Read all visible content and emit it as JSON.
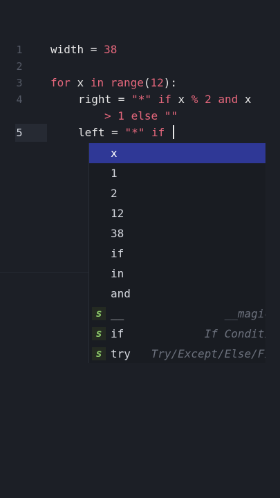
{
  "lines": [
    {
      "num": "1",
      "parts": [
        "width",
        " = ",
        "38"
      ]
    },
    {
      "num": "2"
    },
    {
      "num": "3",
      "parts": [
        "for",
        " x ",
        "in",
        " ",
        "range",
        "(",
        "12",
        "):"
      ]
    },
    {
      "num": "4",
      "parts": [
        "right",
        " = ",
        "\"*\"",
        " ",
        "if",
        " x ",
        "%",
        " ",
        "2",
        " ",
        "and",
        " x"
      ]
    },
    {
      "num": "",
      "parts": [
        ">",
        " ",
        "1",
        " ",
        "else",
        " ",
        "\"\""
      ]
    },
    {
      "num": "5",
      "parts": [
        "left",
        " = ",
        "\"*\"",
        " ",
        "if",
        " "
      ]
    }
  ],
  "suggestions": [
    {
      "label": "x"
    },
    {
      "label": "1"
    },
    {
      "label": "2"
    },
    {
      "label": "12"
    },
    {
      "label": "38"
    },
    {
      "label": "if"
    },
    {
      "label": "in"
    },
    {
      "label": "and"
    },
    {
      "label": "__",
      "snippet": "s",
      "detail": "__magic"
    },
    {
      "label": "if",
      "snippet": "s",
      "detail": "If Conditi"
    },
    {
      "label": "try",
      "snippet": "s",
      "detail": "Try/Except/Else/Fi"
    }
  ],
  "colors": {
    "background": "#1c1f26",
    "keyword": "#e5677c",
    "selection": "#2f3896",
    "snippet": "#8fcf6a"
  }
}
